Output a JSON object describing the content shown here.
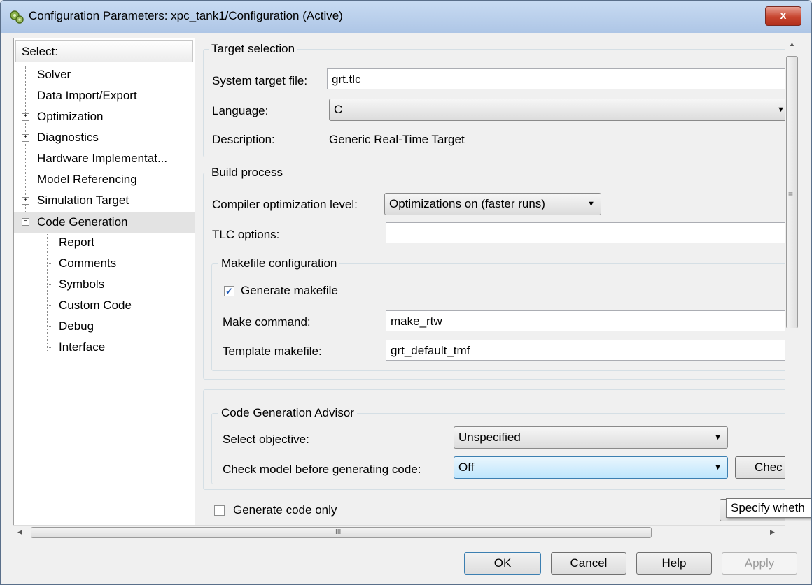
{
  "window": {
    "title": "Configuration Parameters: xpc_tank1/Configuration (Active)",
    "close_label": "x"
  },
  "tree": {
    "header": "Select:",
    "items": [
      {
        "label": "Solver"
      },
      {
        "label": "Data Import/Export"
      },
      {
        "label": "Optimization",
        "expander": "+"
      },
      {
        "label": "Diagnostics",
        "expander": "+"
      },
      {
        "label": "Hardware Implementat..."
      },
      {
        "label": "Model Referencing"
      },
      {
        "label": "Simulation Target",
        "expander": "+"
      },
      {
        "label": "Code Generation",
        "expander": "−",
        "selected": true
      },
      {
        "label": "Report"
      },
      {
        "label": "Comments"
      },
      {
        "label": "Symbols"
      },
      {
        "label": "Custom Code"
      },
      {
        "label": "Debug"
      },
      {
        "label": "Interface"
      }
    ]
  },
  "target_selection": {
    "title": "Target selection",
    "system_target_file_label": "System target file:",
    "system_target_file_value": "grt.tlc",
    "language_label": "Language:",
    "language_value": "C",
    "description_label": "Description:",
    "description_value": "Generic Real-Time Target"
  },
  "build_process": {
    "title": "Build process",
    "compiler_opt_label": "Compiler optimization level:",
    "compiler_opt_value": "Optimizations on (faster runs)",
    "tlc_options_label": "TLC options:",
    "tlc_options_value": "",
    "makefile": {
      "title": "Makefile configuration",
      "generate_makefile_label": "Generate makefile",
      "generate_makefile_checked": true,
      "make_command_label": "Make command:",
      "make_command_value": "make_rtw",
      "template_makefile_label": "Template makefile:",
      "template_makefile_value": "grt_default_tmf"
    }
  },
  "advisor": {
    "title": "Code Generation Advisor",
    "select_objective_label": "Select objective:",
    "select_objective_value": "Unspecified",
    "check_model_label": "Check model before generating code:",
    "check_model_value": "Off",
    "check_button_label": "Chec"
  },
  "generate_code_only": {
    "label": "Generate code only",
    "checked": false
  },
  "tooltip": "Specify wheth",
  "hscroll_grip": "III",
  "vscroll_grip": "≡",
  "buttons": {
    "ok": "OK",
    "cancel": "Cancel",
    "help": "Help",
    "apply": "Apply"
  }
}
